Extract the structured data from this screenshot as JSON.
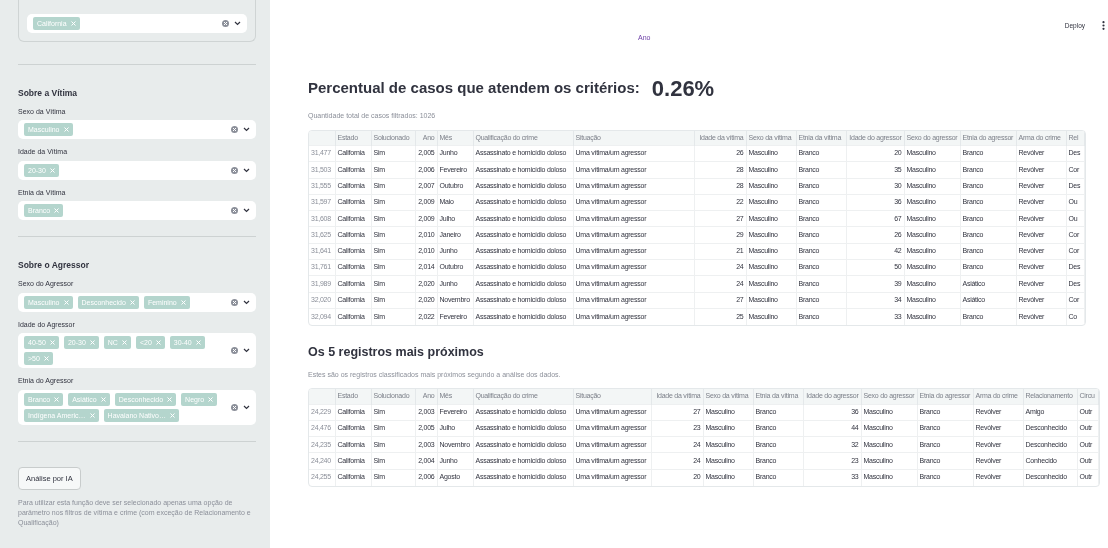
{
  "sidebar": {
    "top_filter": {
      "tags": [
        "California"
      ]
    },
    "sections": [
      {
        "title": "Sobre a Vítima",
        "filters": [
          {
            "label": "Sexo da Vítima",
            "tags": [
              "Masculino"
            ]
          },
          {
            "label": "Idade da Vítima",
            "tags": [
              "20-30"
            ]
          },
          {
            "label": "Etnia da Vítima",
            "tags": [
              "Branco"
            ]
          }
        ]
      },
      {
        "title": "Sobre o Agressor",
        "filters": [
          {
            "label": "Sexo do Agressor",
            "tags": [
              "Masculino",
              "Desconhecido",
              "Feminino"
            ]
          },
          {
            "label": "Idade do Agressor",
            "tags": [
              "40-50",
              "20-30",
              "NC",
              "<20",
              "30-40",
              ">50"
            ]
          },
          {
            "label": "Etnia do Agressor",
            "tags": [
              "Branco",
              "Asiático",
              "Desconhecido",
              "Negro",
              "Indígena Americ…",
              "Havaiano Nativo…"
            ]
          }
        ]
      }
    ],
    "button": "Análise por IA",
    "help": "Para utilizar esta função deve ser selecionado apenas uma opção de parâmetro nos filtros de vítima e crime (com exceção de Relacionamento e Qualificação)"
  },
  "header": {
    "deploy": "Deploy",
    "axis_label": "Ano"
  },
  "metric": {
    "label": "Percentual de casos que atendem os critérios:",
    "value": "0.26%",
    "caption": "Quantidade total de casos filtrados: 1026"
  },
  "table": {
    "columns": [
      {
        "label": "Estado",
        "numeric": false
      },
      {
        "label": "Solucionado",
        "numeric": false
      },
      {
        "label": "Ano",
        "numeric": true
      },
      {
        "label": "Mês",
        "numeric": false
      },
      {
        "label": "Qualificação do crime",
        "numeric": false
      },
      {
        "label": "Situação",
        "numeric": false
      },
      {
        "label": "Idade da vítima",
        "numeric": true
      },
      {
        "label": "Sexo da vítima",
        "numeric": false
      },
      {
        "label": "Etnia da vítima",
        "numeric": false
      },
      {
        "label": "Idade do agressor",
        "numeric": true
      },
      {
        "label": "Sexo do agressor",
        "numeric": false
      },
      {
        "label": "Etnia do agressor",
        "numeric": false
      },
      {
        "label": "Arma do crime",
        "numeric": false
      },
      {
        "label": "Rel",
        "numeric": false
      }
    ],
    "rows": [
      {
        "index": "31,477",
        "cells": [
          "California",
          "Sim",
          "2,005",
          "Junho",
          "Assassinato e homicídio doloso",
          "Uma vítima/um agressor",
          "26",
          "Masculino",
          "Branco",
          "20",
          "Masculino",
          "Branco",
          "Revólver",
          "Des"
        ]
      },
      {
        "index": "31,503",
        "cells": [
          "California",
          "Sim",
          "2,006",
          "Fevereiro",
          "Assassinato e homicídio doloso",
          "Uma vítima/um agressor",
          "28",
          "Masculino",
          "Branco",
          "35",
          "Masculino",
          "Branco",
          "Revólver",
          "Cor"
        ]
      },
      {
        "index": "31,555",
        "cells": [
          "California",
          "Sim",
          "2,007",
          "Outubro",
          "Assassinato e homicídio doloso",
          "Uma vítima/um agressor",
          "28",
          "Masculino",
          "Branco",
          "30",
          "Masculino",
          "Branco",
          "Revólver",
          "Des"
        ]
      },
      {
        "index": "31,597",
        "cells": [
          "California",
          "Sim",
          "2,009",
          "Maio",
          "Assassinato e homicídio doloso",
          "Uma vítima/um agressor",
          "22",
          "Masculino",
          "Branco",
          "36",
          "Masculino",
          "Branco",
          "Revólver",
          "Ou"
        ]
      },
      {
        "index": "31,608",
        "cells": [
          "California",
          "Sim",
          "2,009",
          "Julho",
          "Assassinato e homicídio doloso",
          "Uma vítima/um agressor",
          "27",
          "Masculino",
          "Branco",
          "67",
          "Masculino",
          "Branco",
          "Revólver",
          "Ou"
        ]
      },
      {
        "index": "31,625",
        "cells": [
          "California",
          "Sim",
          "2,010",
          "Janeiro",
          "Assassinato e homicídio doloso",
          "Uma vítima/um agressor",
          "29",
          "Masculino",
          "Branco",
          "26",
          "Masculino",
          "Branco",
          "Revólver",
          "Cor"
        ]
      },
      {
        "index": "31,641",
        "cells": [
          "California",
          "Sim",
          "2,010",
          "Junho",
          "Assassinato e homicídio doloso",
          "Uma vítima/um agressor",
          "21",
          "Masculino",
          "Branco",
          "42",
          "Masculino",
          "Branco",
          "Revólver",
          "Cor"
        ]
      },
      {
        "index": "31,761",
        "cells": [
          "California",
          "Sim",
          "2,014",
          "Outubro",
          "Assassinato e homicídio doloso",
          "Uma vítima/um agressor",
          "24",
          "Masculino",
          "Branco",
          "50",
          "Masculino",
          "Branco",
          "Revólver",
          "Des"
        ]
      },
      {
        "index": "31,989",
        "cells": [
          "California",
          "Sim",
          "2,020",
          "Junho",
          "Assassinato e homicídio doloso",
          "Uma vítima/um agressor",
          "24",
          "Masculino",
          "Branco",
          "39",
          "Masculino",
          "Asiático",
          "Revólver",
          "Des"
        ]
      },
      {
        "index": "32,020",
        "cells": [
          "California",
          "Sim",
          "2,020",
          "Novembro",
          "Assassinato e homicídio doloso",
          "Uma vítima/um agressor",
          "27",
          "Masculino",
          "Branco",
          "34",
          "Masculino",
          "Asiático",
          "Revólver",
          "Cor"
        ]
      },
      {
        "index": "32,094",
        "cells": [
          "California",
          "Sim",
          "2,022",
          "Fevereiro",
          "Assassinato e homicídio doloso",
          "Uma vítima/um agressor",
          "25",
          "Masculino",
          "Branco",
          "33",
          "Masculino",
          "Branco",
          "Revólver",
          "Co"
        ]
      }
    ]
  },
  "nearest": {
    "title": "Os 5 registros mais próximos",
    "caption": "Estes são os registros classificados mais próximos segundo a análise dos dados.",
    "columns": [
      {
        "label": "Estado",
        "numeric": false
      },
      {
        "label": "Solucionado",
        "numeric": false
      },
      {
        "label": "Ano",
        "numeric": true
      },
      {
        "label": "Mês",
        "numeric": false
      },
      {
        "label": "Qualificação do crime",
        "numeric": false
      },
      {
        "label": "Situação",
        "numeric": false
      },
      {
        "label": "Idade da vítima",
        "numeric": true
      },
      {
        "label": "Sexo da vítima",
        "numeric": false
      },
      {
        "label": "Etnia da vítima",
        "numeric": false
      },
      {
        "label": "Idade do agressor",
        "numeric": true
      },
      {
        "label": "Sexo do agressor",
        "numeric": false
      },
      {
        "label": "Etnia do agressor",
        "numeric": false
      },
      {
        "label": "Arma do crime",
        "numeric": false
      },
      {
        "label": "Relacionamento",
        "numeric": false
      },
      {
        "label": "Circu",
        "numeric": false
      }
    ],
    "rows": [
      {
        "index": "24,229",
        "cells": [
          "California",
          "Sim",
          "2,003",
          "Fevereiro",
          "Assassinato e homicídio doloso",
          "Uma vítima/um agressor",
          "27",
          "Masculino",
          "Branco",
          "36",
          "Masculino",
          "Branco",
          "Revólver",
          "Amigo",
          "Outr"
        ]
      },
      {
        "index": "24,476",
        "cells": [
          "California",
          "Sim",
          "2,005",
          "Julho",
          "Assassinato e homicídio doloso",
          "Uma vítima/um agressor",
          "23",
          "Masculino",
          "Branco",
          "44",
          "Masculino",
          "Branco",
          "Revólver",
          "Desconhecido",
          "Outr"
        ]
      },
      {
        "index": "24,235",
        "cells": [
          "California",
          "Sim",
          "2,003",
          "Novembro",
          "Assassinato e homicídio doloso",
          "Uma vítima/um agressor",
          "24",
          "Masculino",
          "Branco",
          "32",
          "Masculino",
          "Branco",
          "Revólver",
          "Desconhecido",
          "Outr"
        ]
      },
      {
        "index": "24,240",
        "cells": [
          "California",
          "Sim",
          "2,004",
          "Junho",
          "Assassinato e homicídio doloso",
          "Uma vítima/um agressor",
          "24",
          "Masculino",
          "Branco",
          "23",
          "Masculino",
          "Branco",
          "Revólver",
          "Conhecido",
          "Outr"
        ]
      },
      {
        "index": "24,255",
        "cells": [
          "California",
          "Sim",
          "2,006",
          "Agosto",
          "Assassinato e homicídio doloso",
          "Uma vítima/um agressor",
          "20",
          "Masculino",
          "Branco",
          "33",
          "Masculino",
          "Branco",
          "Revólver",
          "Desconhecido",
          "Outr"
        ]
      }
    ]
  }
}
